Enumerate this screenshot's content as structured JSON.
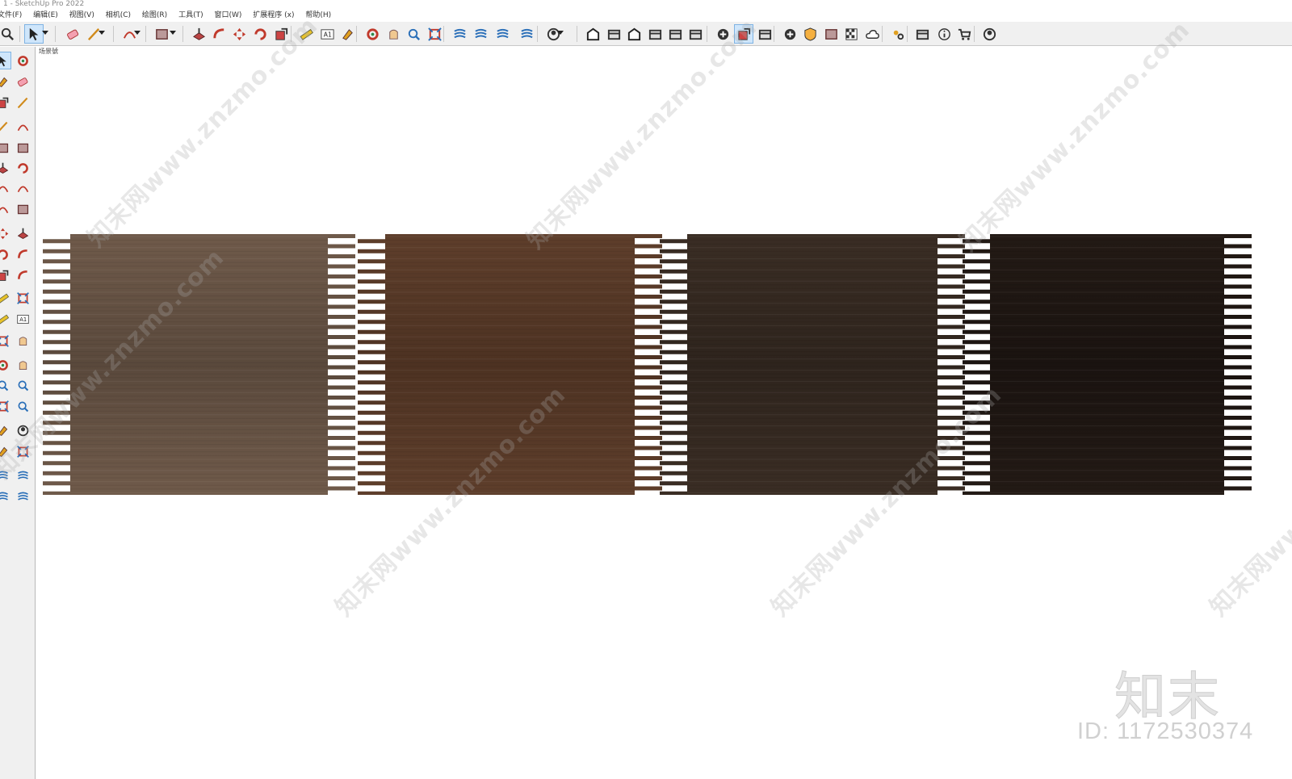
{
  "window": {
    "title": "1 - SketchUp Pro 2022"
  },
  "menu": [
    "文件(F)",
    "编辑(E)",
    "视图(V)",
    "相机(C)",
    "绘图(R)",
    "工具(T)",
    "窗口(W)",
    "扩展程序 (x)",
    "帮助(H)"
  ],
  "scene_tab": "场景號",
  "swatches": [
    {
      "name": "swatch-1",
      "color": "#6f5a4a",
      "color_dark": "#5a493c"
    },
    {
      "name": "swatch-2",
      "color": "#5e3e2b",
      "color_dark": "#4d3222"
    },
    {
      "name": "swatch-3",
      "color": "#3a2d24",
      "color_dark": "#2e241d"
    },
    {
      "name": "swatch-4",
      "color": "#231a15",
      "color_dark": "#1a1310"
    }
  ],
  "watermarks": {
    "url": "知末网www.znzmo.com",
    "brand": "知末",
    "image_id": "ID: 1172530374"
  },
  "toolbar_icons": [
    "zoom-icon",
    "select-icon",
    "eraser-icon",
    "pencil-line-icon",
    "arc-icon",
    "rectangle-icon",
    "push-pull-icon",
    "follow-me-icon",
    "move-icon",
    "rotate-icon",
    "scale-icon",
    "tape-measure-icon",
    "text-icon",
    "paint-bucket-icon",
    "orbit-icon",
    "pan-icon",
    "zoom-window-icon",
    "zoom-extents-icon",
    "sandbox-contours-icon",
    "sandbox-smoove-icon",
    "sandbox-stamp-icon",
    "sandbox-drape-icon",
    "account-icon",
    "iso-view-icon",
    "top-view-icon",
    "front-view-icon",
    "right-view-icon",
    "back-view-icon",
    "left-view-icon",
    "warehouse-icon",
    "extension-warehouse-icon",
    "send-to-layout-icon",
    "camera-icon",
    "add-location-icon",
    "shield-icon",
    "styles-icon",
    "checker-icon",
    "cloud-icon",
    "settings-icon",
    "dialog-icon",
    "info-icon",
    "cart-icon",
    "user-circle-icon"
  ]
}
